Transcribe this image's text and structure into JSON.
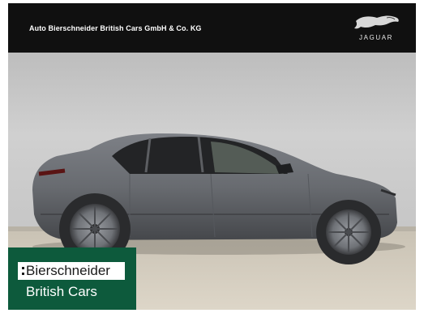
{
  "header": {
    "dealer_name": "Auto Bierschneider British Cars GmbH & Co. KG",
    "brand_wordmark": "JAGUAR"
  },
  "photo": {
    "subject_icon": "car-photo",
    "car_color": "#6b6e73",
    "wall_color": "#c9c9c9",
    "ground_color": "#d6cfc1"
  },
  "badge": {
    "line1": "Bierschneider",
    "line2": "British Cars",
    "background": "#0d5a3c"
  }
}
